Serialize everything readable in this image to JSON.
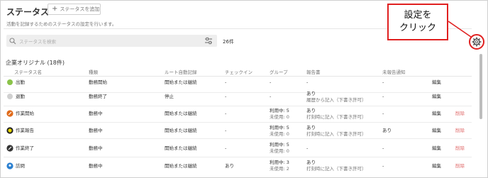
{
  "header": {
    "title": "ステータス",
    "add_button_label": "ステータスを追加",
    "subtitle": "活動を記録するためのステータスの設定を行います。"
  },
  "search": {
    "placeholder": "ステータスを検索",
    "count": "26件"
  },
  "group": {
    "title": "企業オリジナル (18件)"
  },
  "columns": {
    "status_name": "ステータス名",
    "type": "種類",
    "route_auto": "ルート自動記録",
    "checkin": "チェックイン",
    "group": "グループ",
    "report": "報告書",
    "unreported": "未報告通知"
  },
  "rows": [
    {
      "name": "出勤",
      "type": "勤務開始",
      "route": "開始または継続",
      "checkin": "-",
      "group1": "-",
      "group2": "",
      "report1": "-",
      "report2": "",
      "notice": "-",
      "edit": "編集",
      "delete": "",
      "icon": "green-dot-icon",
      "color": "#8bc34a"
    },
    {
      "name": "退勤",
      "type": "勤務終了",
      "route": "停止",
      "checkin": "-",
      "group1": "-",
      "group2": "",
      "report1": "あり",
      "report2": "履歴から記入（下書き許可）",
      "notice": "-",
      "edit": "編集",
      "delete": "",
      "icon": "gray-dot-icon",
      "color": "#c8c8c8"
    },
    {
      "name": "作業開始",
      "type": "勤務中",
      "route": "開始または継続",
      "checkin": "-",
      "group1": "利用中: 5",
      "group2": "未使用: 0",
      "report1": "あり",
      "report2": "打刻時に記入（下書き許可）",
      "notice": "-",
      "edit": "編集",
      "delete": "削除",
      "icon": "wrench-icon",
      "color": "#e06a1a"
    },
    {
      "name": "作業報告",
      "type": "勤務中",
      "route": "開始または継続",
      "checkin": "-",
      "group1": "利用中: 5",
      "group2": "未使用: 0",
      "report1": "あり",
      "report2": "打刻時に記入（下書き許可）",
      "notice": "あり",
      "edit": "編集",
      "delete": "削除",
      "icon": "target-icon",
      "color": "#e0d000"
    },
    {
      "name": "作業終了",
      "type": "勤務中",
      "route": "開始または継続",
      "checkin": "-",
      "group1": "利用中: 5",
      "group2": "未使用: 0",
      "report1": "-",
      "report2": "",
      "notice": "-",
      "edit": "編集",
      "delete": "削除",
      "icon": "tool-icon",
      "color": "#444444"
    },
    {
      "name": "訪問",
      "type": "勤務中",
      "route": "開始または継続",
      "checkin": "あり",
      "group1": "利用中: 3",
      "group2": "未使用: 2",
      "report1": "あり",
      "report2": "打刻時に記入（下書き許可）",
      "notice": "-",
      "edit": "編集",
      "delete": "削除",
      "icon": "pin-icon",
      "color": "#2a7fd0"
    }
  ],
  "callout": {
    "line1": "設定を",
    "line2": "クリック"
  }
}
